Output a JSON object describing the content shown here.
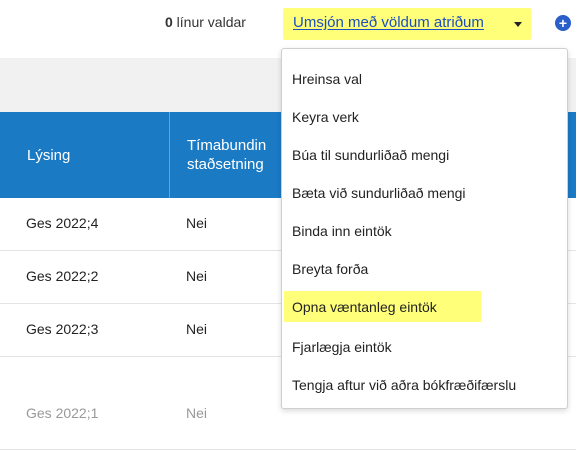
{
  "toolbar": {
    "selected_count": "0",
    "selected_suffix": " línur valdar",
    "actions_label": "Umsjón með völdum atriðum",
    "highlight_color": "#ffff7a",
    "link_color": "#1b4fbf",
    "add_icon": "plus-circle-icon"
  },
  "table": {
    "header_color": "#1b7ac4",
    "columns": [
      "Lýsing",
      "Tímabundin\nstaðsetning"
    ],
    "rows": [
      {
        "lysing": "Ges 2022;4",
        "timabundin": "Nei"
      },
      {
        "lysing": "Ges 2022;2",
        "timabundin": "Nei"
      },
      {
        "lysing": "Ges 2022;3",
        "timabundin": "Nei"
      },
      {
        "lysing": "Ges 2022;1",
        "timabundin": "Nei"
      }
    ]
  },
  "menu": {
    "items": [
      "Hreinsa val",
      "Keyra verk",
      "Búa til sundurliðað mengi",
      "Bæta við sundurliðað mengi",
      "Binda inn eintök",
      "Breyta forða",
      "Opna væntanleg eintök",
      "Fjarlægja eintök",
      "Tengja aftur við aðra bókfræðifærslu"
    ],
    "highlighted_item": "Opna væntanleg eintök"
  }
}
